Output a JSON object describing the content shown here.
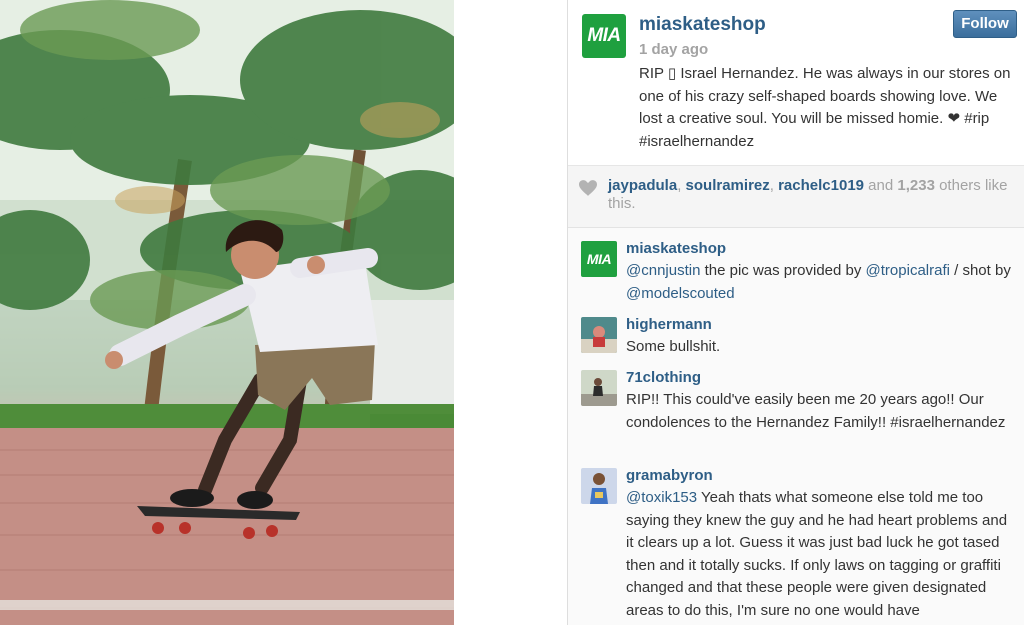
{
  "post": {
    "owner": "miaskateshop",
    "owner_avatar_text": "MIA",
    "time": "1 day ago",
    "follow_label": "Follow",
    "caption": "RIP ▯ Israel Hernandez. He was always in our stores on one of his crazy self-shaped boards showing love. We lost a creative soul. You will be missed homie. ❤ #rip #israelhernandez"
  },
  "likes": {
    "users": [
      "jaypadula",
      "soulramirez",
      "rachelc1019"
    ],
    "sep": ", ",
    "and_text": " and ",
    "count": "1,233",
    "suffix": " others like this."
  },
  "comments": [
    {
      "user": "miaskateshop",
      "avatar": "MIA",
      "mention1": "@cnnjustin",
      "text1": " the pic was provided by ",
      "mention2": "@tropicalrafi",
      "text2": " / shot by ",
      "mention3": "@modelscouted"
    },
    {
      "user": "highermann",
      "text": "Some bullshit."
    },
    {
      "user": "71clothing",
      "text": "RIP!! This could've easily been me 20 years ago!! Our condolences to the Hernandez Family!! #israelhernandez"
    },
    {
      "user": "gramabyron",
      "mention": "@toxik153",
      "text": " Yeah thats what someone else told me too saying they knew the guy and he had heart problems and it clears up a lot. Guess it was just bad luck he got tased then and it totally sucks. If only laws on tagging or graffiti changed and that these people were given designated areas to do this, I'm sure no one would have"
    }
  ],
  "colors": {
    "username": "#2e5e86",
    "follow_button": "#4a7cab",
    "mia_green": "#1fa03f",
    "muted": "#a3a3a3"
  },
  "icons": {
    "like": "heart-icon"
  }
}
